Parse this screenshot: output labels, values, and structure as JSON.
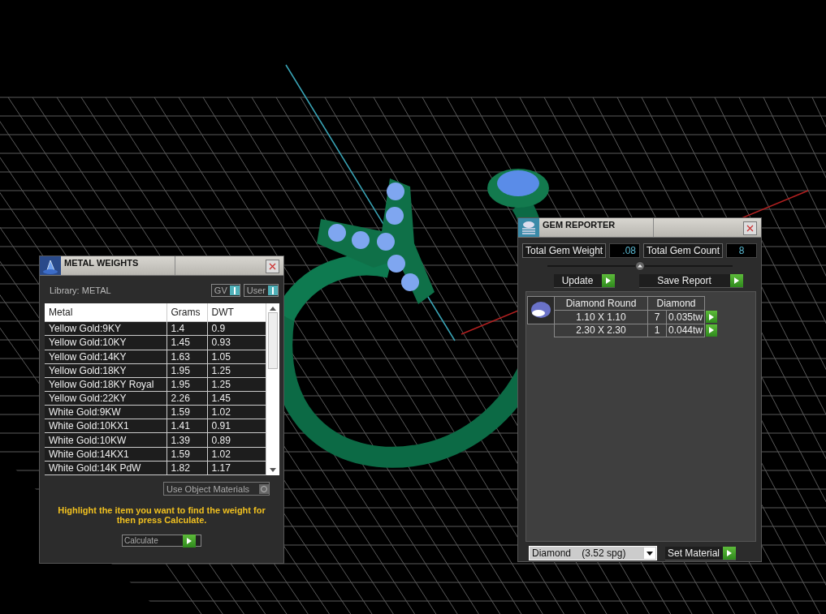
{
  "metal_weights": {
    "title": "METAL WEIGHTS",
    "library_label": "Library: METAL",
    "toggles": [
      {
        "label": "GV",
        "on": true
      },
      {
        "label": "User",
        "on": true
      }
    ],
    "table": {
      "columns": [
        "Metal",
        "Grams",
        "DWT"
      ],
      "rows": [
        [
          "Yellow Gold:9KY",
          "1.4",
          "0.9"
        ],
        [
          "Yellow Gold:10KY",
          "1.45",
          "0.93"
        ],
        [
          "Yellow Gold:14KY",
          "1.63",
          "1.05"
        ],
        [
          "Yellow Gold:18KY",
          "1.95",
          "1.25"
        ],
        [
          "Yellow Gold:18KY Royal",
          "1.95",
          "1.25"
        ],
        [
          "Yellow Gold:22KY",
          "2.26",
          "1.45"
        ],
        [
          "White Gold:9KW",
          "1.59",
          "1.02"
        ],
        [
          "White Gold:10KX1",
          "1.41",
          "0.91"
        ],
        [
          "White Gold:10KW",
          "1.39",
          "0.89"
        ],
        [
          "White Gold:14KX1",
          "1.59",
          "1.02"
        ],
        [
          "White Gold:14K PdW",
          "1.82",
          "1.17"
        ]
      ]
    },
    "use_object_materials": {
      "label": "Use Object Materials",
      "on": false
    },
    "hint": "Highlight the item you want to find the weight for then press Calculate.",
    "calculate_button": "Calculate"
  },
  "gem_reporter": {
    "title": "GEM REPORTER",
    "totals": [
      {
        "label": "Total Gem Weight",
        "value": ".08"
      },
      {
        "label": "Total Gem Count",
        "value": "8"
      }
    ],
    "buttons": [
      "Update",
      "Save Report"
    ],
    "table": {
      "columns": [
        "Diamond Round",
        "Diamond"
      ],
      "rows": [
        {
          "size": "1.10 X 1.10",
          "count": "7",
          "weight": "0.035tw"
        },
        {
          "size": "2.30 X 2.30",
          "count": "1",
          "weight": "0.044tw"
        }
      ]
    },
    "material": "Diamond    (3.52 spg)",
    "set_material_button": "Set Material"
  }
}
